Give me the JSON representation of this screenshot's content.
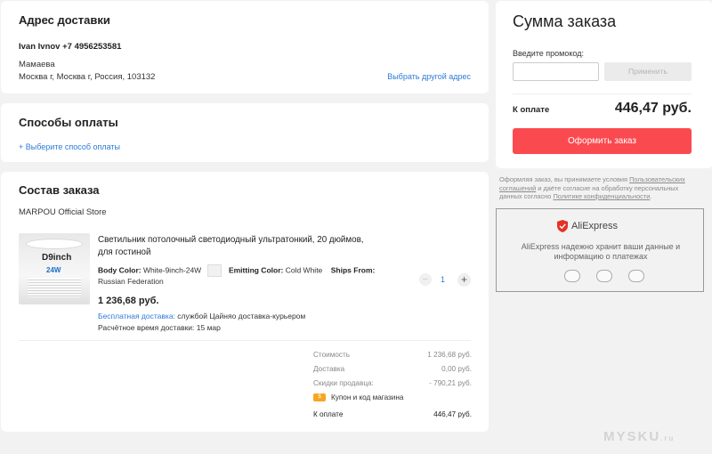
{
  "address": {
    "title": "Адрес доставки",
    "recipient": "Ivan Ivnov +7 4956253581",
    "line1": "Мамаева",
    "line2": "Москва г, Москва г, Россия, 103132",
    "change_link": "Выбрать другой адрес"
  },
  "payment": {
    "title": "Способы оплаты",
    "select_link": "+ Выберите способ оплаты"
  },
  "order": {
    "title": "Состав заказа",
    "store": "MARPOU Official Store",
    "product": {
      "image_text_model": "D9inch",
      "image_text_power": "24W",
      "title": "Светильник потолочный светодиодный ультратонкий, 20 дюймов, для гостиной",
      "body_color_label": "Body Color:",
      "body_color_value": "White-9inch-24W",
      "emitting_color_label": "Emitting Color:",
      "emitting_color_value": "Cold White",
      "ships_from_label": "Ships From:",
      "ships_from_value": "Russian Federation",
      "price": "1 236,68 руб.",
      "free_shipping": "Бесплатная доставка:",
      "shipping_service": " службой Цайняо доставка-курьером",
      "delivery_time": "Расчётное время доставки: 15 мар",
      "quantity": "1",
      "qty_minus": "−",
      "qty_plus": "+"
    },
    "summary": {
      "cost_label": "Стоимость",
      "cost_value": "1 236,68 руб.",
      "delivery_label": "Доставка",
      "delivery_value": "0,00 руб.",
      "discount_label": "Скидки продавца:",
      "discount_value": "- 790,21 руб.",
      "coupon_label": "Купон и код магазина",
      "total_label": "К оплате",
      "total_value": "446,47 руб."
    }
  },
  "sum": {
    "title": "Сумма заказа",
    "promo_label": "Введите промокод:",
    "promo_placeholder": "",
    "apply_button": "Применить",
    "pay_label": "К оплате",
    "pay_value": "446,47 руб.",
    "checkout_button": "Оформить заказ"
  },
  "terms": {
    "t1": "Оформляя заказ, вы принимаете условия ",
    "link1": "Пользовательских соглашений",
    "t2": " и даёте согласие на обработку персональных данных согласно ",
    "link2": "Политике конфиденциальности",
    "t3": "."
  },
  "trust": {
    "brand": "AliExpress",
    "message": "AliExpress надежно хранит ваши данные и информацию о платежах"
  },
  "watermark": {
    "main": "MYSKU",
    "sub": ".ru"
  },
  "colors": {
    "accent": "#fb4a4f",
    "link": "#2e7ad6",
    "coupon": "#f6a623"
  }
}
